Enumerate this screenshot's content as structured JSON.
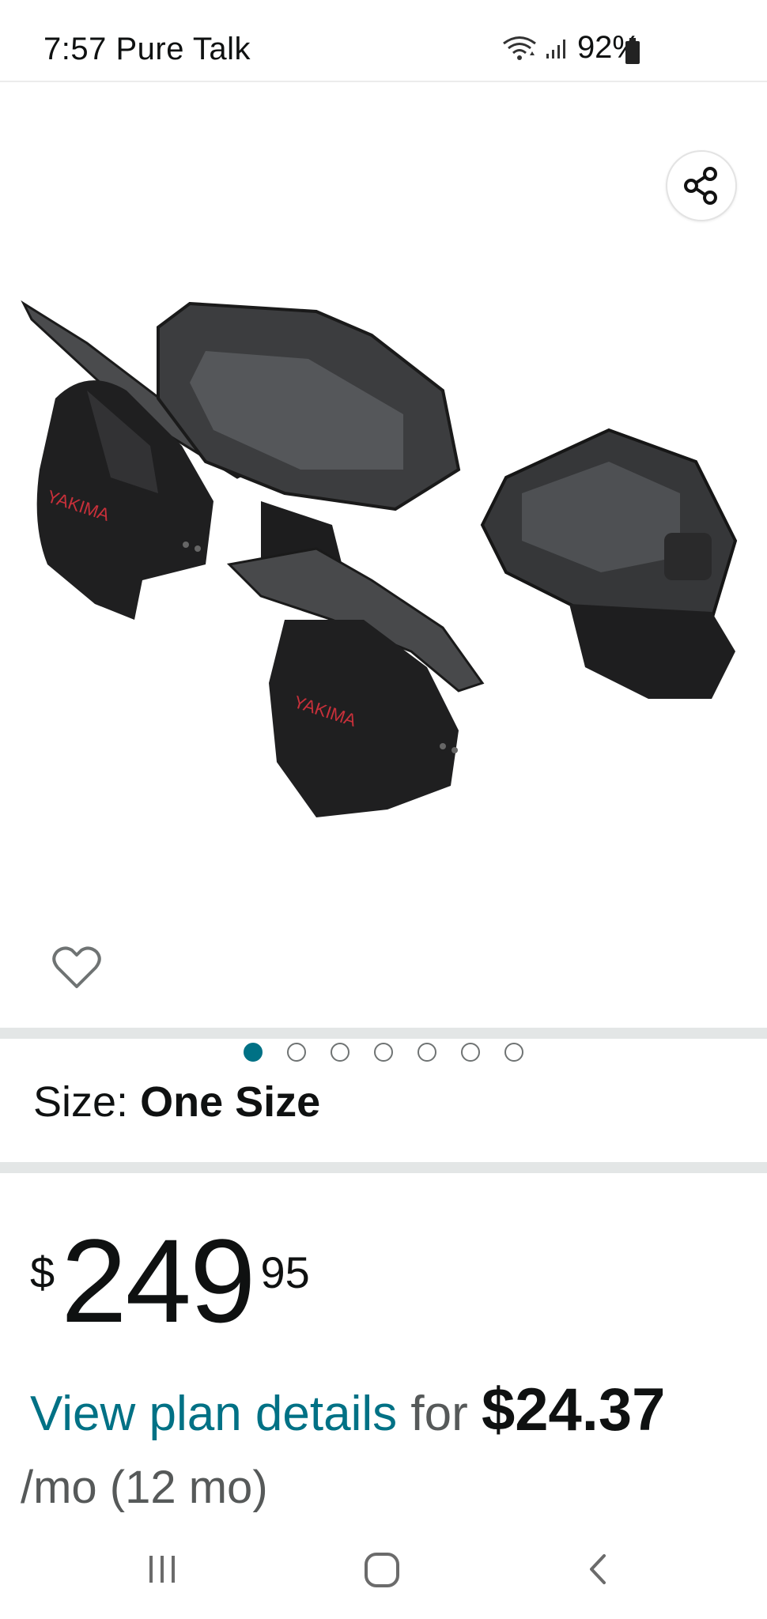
{
  "status_bar": {
    "time_carrier": "7:57 Pure Talk",
    "battery": "92%",
    "icons": [
      "wifi-icon",
      "signal-icon",
      "battery-icon"
    ]
  },
  "product": {
    "image_alt": "Product image",
    "carousel": {
      "count": 7,
      "active_index": 0
    },
    "icons": [
      "share-icon",
      "heart-icon"
    ]
  },
  "size": {
    "label": "Size:",
    "value": "One Size"
  },
  "price": {
    "symbol": "$",
    "whole": "249",
    "fraction": "95"
  },
  "plan": {
    "link_text": "View plan details",
    "connector": "for",
    "amount": "$24.37",
    "term": "/mo (12 mo)"
  },
  "nav_bar": {
    "icons": [
      "recent-apps-icon",
      "home-icon",
      "back-icon"
    ]
  },
  "colors": {
    "link": "#007185",
    "active_dot": "#007185",
    "divider": "#e3e6e6"
  }
}
